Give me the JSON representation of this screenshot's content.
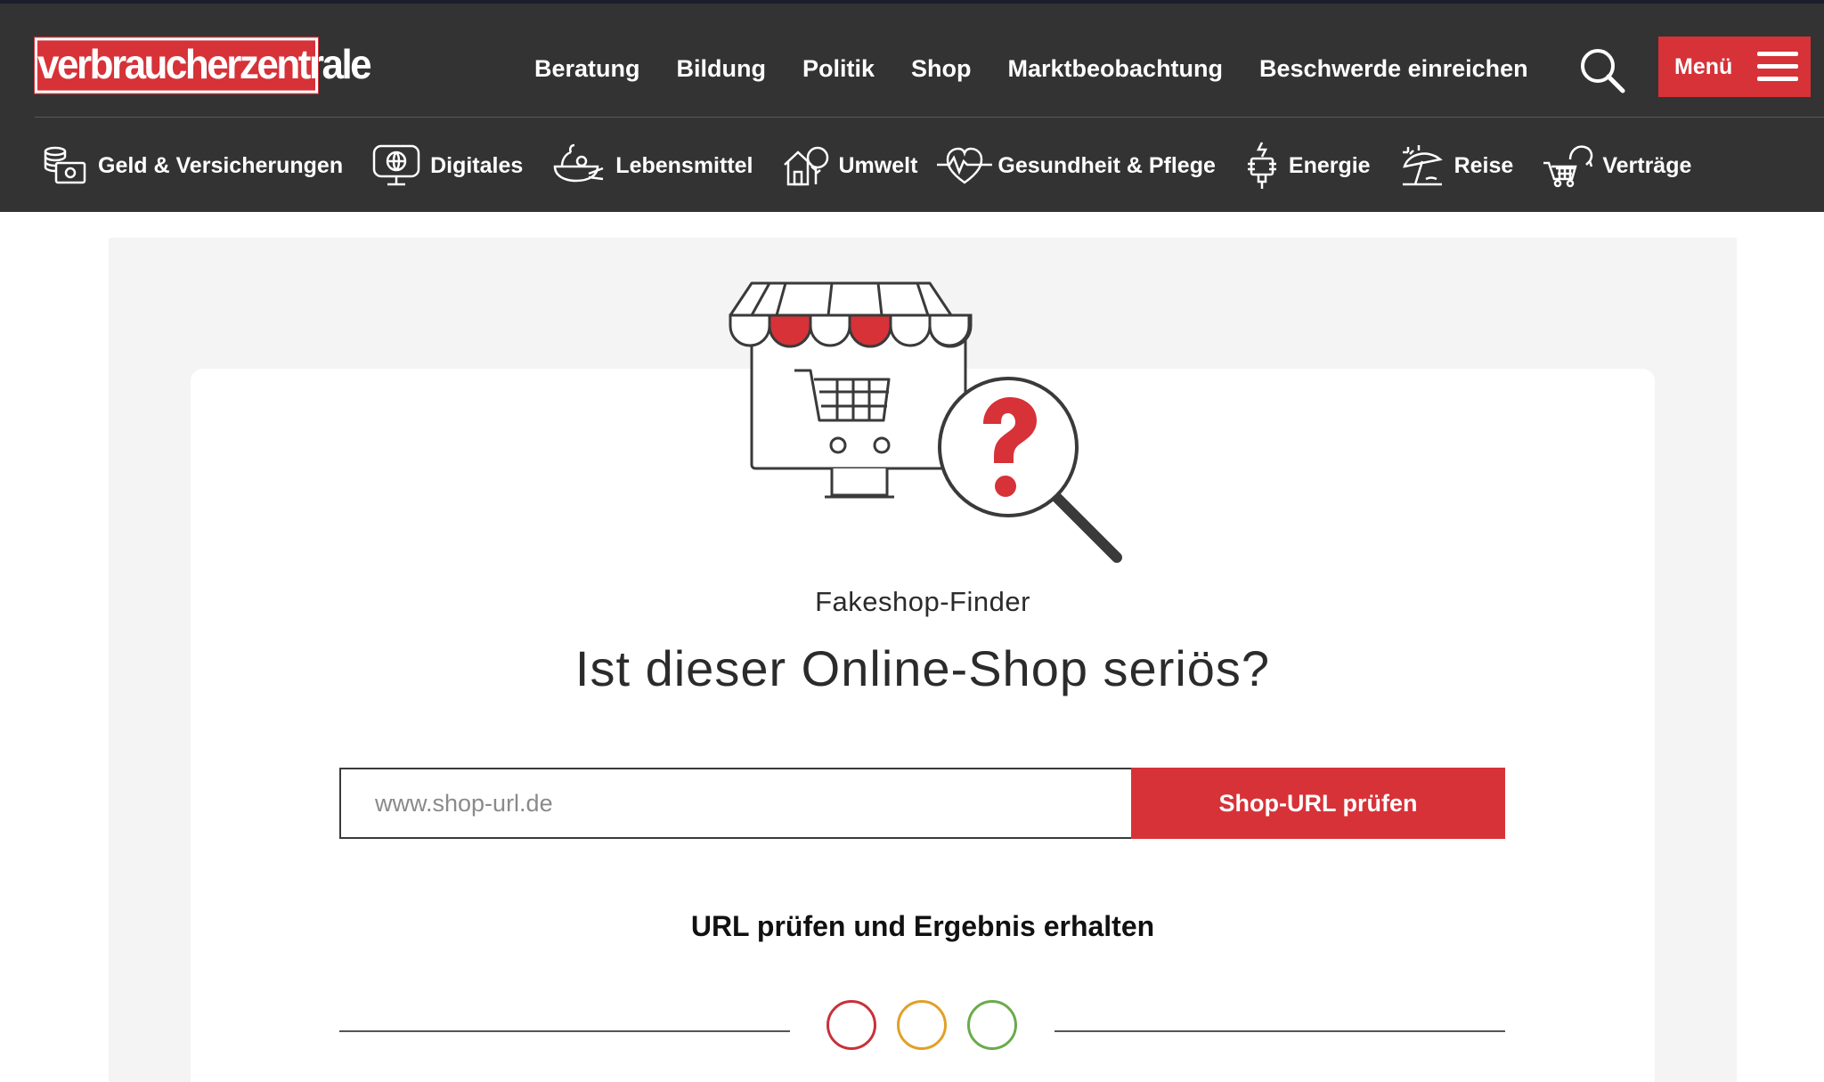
{
  "header": {
    "logo_text": "verbraucherzentrale",
    "nav": [
      {
        "label": "Beratung"
      },
      {
        "label": "Bildung"
      },
      {
        "label": "Politik"
      },
      {
        "label": "Shop"
      },
      {
        "label": "Marktbeobachtung"
      },
      {
        "label": "Beschwerde einreichen"
      }
    ],
    "search_icon": "search-icon",
    "menu_label": "Menü",
    "menu_icon": "hamburger-icon"
  },
  "topics": [
    {
      "label": "Geld & Versicherungen",
      "icon": "money-coins-icon"
    },
    {
      "label": "Digitales",
      "icon": "monitor-globe-icon"
    },
    {
      "label": "Lebensmittel",
      "icon": "food-bowl-icon"
    },
    {
      "label": "Umwelt",
      "icon": "house-tree-icon"
    },
    {
      "label": "Gesundheit & Pflege",
      "icon": "heartbeat-icon"
    },
    {
      "label": "Energie",
      "icon": "plug-icon"
    },
    {
      "label": "Reise",
      "icon": "beach-umbrella-icon"
    },
    {
      "label": "Verträge",
      "icon": "cart-return-icon"
    }
  ],
  "finder": {
    "illustration": "shop-magnifier-question-icon",
    "eyebrow": "Fakeshop-Finder",
    "headline": "Ist dieser Online-Shop seriös?",
    "input_placeholder": "www.shop-url.de",
    "input_value": "",
    "button_label": "Shop-URL prüfen",
    "result_title": "URL prüfen und Ergebnis erhalten",
    "status_circles": [
      {
        "name": "red",
        "color": "#c8313a"
      },
      {
        "name": "yellow",
        "color": "#e0a128"
      },
      {
        "name": "green",
        "color": "#6aab4b"
      }
    ]
  },
  "colors": {
    "header_bg": "#333333",
    "brand_red": "#d63238",
    "panel_bg": "#f4f4f5",
    "text_dark": "#2b2b2b"
  }
}
